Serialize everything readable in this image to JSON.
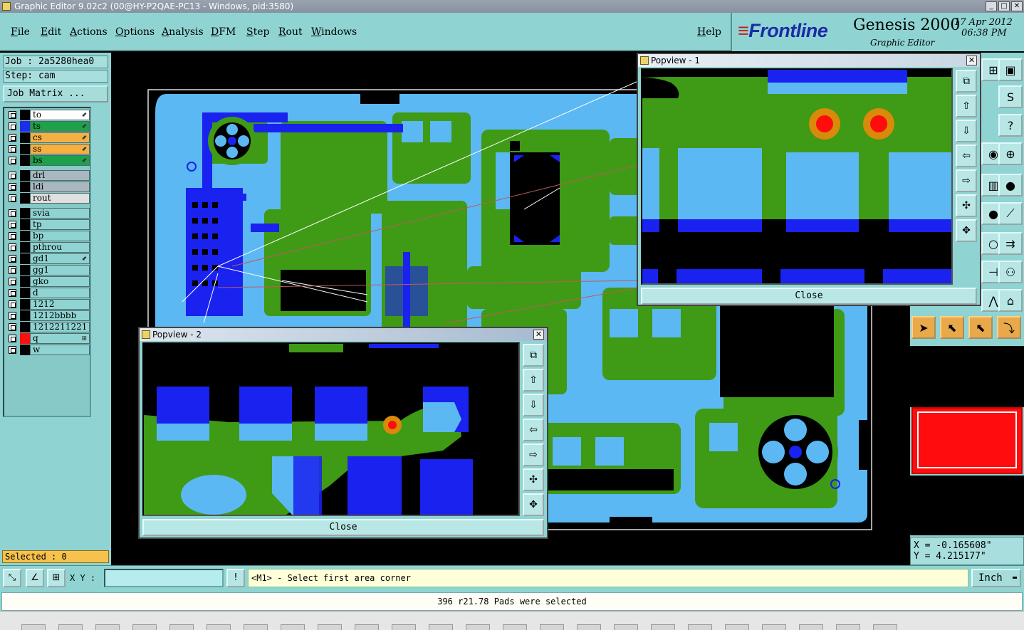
{
  "window": {
    "title": "Graphic Editor 9.02c2 (00@HY-P2QAE-PC13 - Windows, pid:3580)"
  },
  "menu": {
    "items": [
      "File",
      "Edit",
      "Actions",
      "Options",
      "Analysis",
      "DFM",
      "Step",
      "Rout",
      "Windows"
    ],
    "help": "Help"
  },
  "brand": {
    "logo": "Frontline",
    "product": "Genesis 2000",
    "subtitle": "Graphic Editor",
    "date": "17 Apr 2012",
    "time": "06:38 PM"
  },
  "job": {
    "job": "Job : 2a5280hea0",
    "step": "Step: cam",
    "matrix_button": "Job Matrix ..."
  },
  "layers": {
    "group1": [
      {
        "name": "to",
        "color": "#ffffff",
        "swatch": "#000000",
        "affected": true
      },
      {
        "name": "ts",
        "color": "#1fa04a",
        "swatch": "#1e2ee8",
        "affected": true
      },
      {
        "name": "cs",
        "color": "#f4b040",
        "swatch": "#000000",
        "affected": true
      },
      {
        "name": "ss",
        "color": "#f4b040",
        "swatch": "#000000",
        "affected": true
      },
      {
        "name": "bs",
        "color": "#1fa04a",
        "swatch": "#000000",
        "affected": true
      }
    ],
    "group2": [
      {
        "name": "drl",
        "color": "#a9b8c0",
        "swatch": "#000000"
      },
      {
        "name": "ldi",
        "color": "#a9b8c0",
        "swatch": "#000000"
      },
      {
        "name": "rout",
        "color": "#e0e0e0",
        "swatch": "#000000"
      }
    ],
    "group3": [
      {
        "name": "svia",
        "color": "#8fd4d2",
        "swatch": "#000000"
      },
      {
        "name": "tp",
        "color": "#8fd4d2",
        "swatch": "#000000"
      },
      {
        "name": "bp",
        "color": "#8fd4d2",
        "swatch": "#000000"
      },
      {
        "name": "pthrou",
        "color": "#8fd4d2",
        "swatch": "#000000"
      },
      {
        "name": "gd1",
        "color": "#8fd4d2",
        "swatch": "#000000",
        "affected": true
      },
      {
        "name": "gg1",
        "color": "#8fd4d2",
        "swatch": "#000000"
      },
      {
        "name": "gko",
        "color": "#8fd4d2",
        "swatch": "#000000"
      },
      {
        "name": "d",
        "color": "#8fd4d2",
        "swatch": "#000000"
      },
      {
        "name": "1212",
        "color": "#8fd4d2",
        "swatch": "#000000"
      },
      {
        "name": "1212bbbb",
        "color": "#8fd4d2",
        "swatch": "#000000"
      },
      {
        "name": "1212211221",
        "color": "#8fd4d2",
        "swatch": "#000000"
      },
      {
        "name": "q",
        "color": "#8fd4d2",
        "swatch": "#ff1010",
        "flagged": true
      },
      {
        "name": "w",
        "color": "#8fd4d2",
        "swatch": "#000000"
      }
    ]
  },
  "selected_label": "Selected : 0",
  "popview1": {
    "title": "Popview - 1",
    "close": "Close"
  },
  "popview2": {
    "title": "Popview - 2",
    "close": "Close"
  },
  "coords": {
    "x": "X = -0.165608\"",
    "y": "Y = 4.215177\""
  },
  "cmd": {
    "xy_label": "X Y :",
    "xy_value": "",
    "prompt": "<M1> - Select first area corner",
    "units": "Inch"
  },
  "status": "396 r21.78 Pads were selected",
  "colors": {
    "panel": "#8fd4d2",
    "board": "#5bb8f2",
    "copper": "#3f9a15",
    "pad": "#1a22f0",
    "drill": "#ff0c0c"
  },
  "icons": {
    "popview_buttons": [
      "zoom-fit-icon",
      "pan-up-icon",
      "pan-down-icon",
      "pan-left-icon",
      "pan-right-icon",
      "zoom-in-icon",
      "zoom-out-icon"
    ],
    "right_toolbar": [
      "select-arrow-icon",
      "select-box-icon",
      "select-snap-icon",
      "select-net-icon"
    ]
  }
}
